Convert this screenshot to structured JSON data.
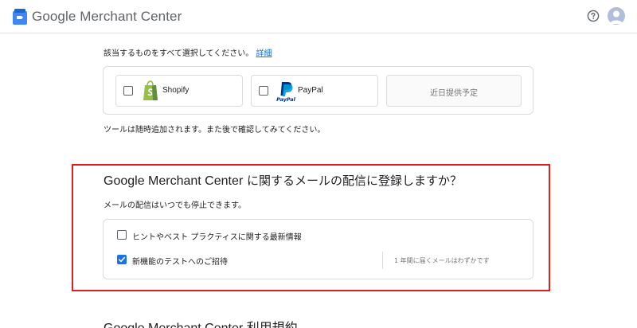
{
  "header": {
    "app_title": "Google Merchant Center",
    "logo_icon": "merchant-center-logo",
    "help_icon": "help-circle-icon",
    "avatar_icon": "account-avatar"
  },
  "partners": {
    "intro": "該当するものをすべて選択してください。",
    "details_link": "詳細",
    "cards": [
      {
        "label": "Shopify",
        "icon": "shopify-bag-icon",
        "checked": false
      },
      {
        "label": "PayPal",
        "icon": "paypal-icon",
        "checked": false
      }
    ],
    "coming_soon": "近日提供予定",
    "note": "ツールは随時追加されます。また後で確認してみてください。"
  },
  "email_signup": {
    "title_en": "Google Merchant Center",
    "title_jp": " に関するメールの配信に登録しますか？",
    "subtitle": "メールの配信はいつでも停止できます。",
    "options": [
      {
        "label": "ヒントやベスト プラクティスに関する最新情報",
        "checked": false
      },
      {
        "label": "新機能のテストへのご招待",
        "checked": true
      }
    ],
    "frequency_note": "1 年間に届くメールはわずかです"
  },
  "terms": {
    "title_en": "Google Merchant Center",
    "title_jp": " 利用規約"
  },
  "colors": {
    "highlight_border": "#e02020",
    "link_blue": "#1a73e8",
    "checkbox_checked": "#1a73e8"
  }
}
